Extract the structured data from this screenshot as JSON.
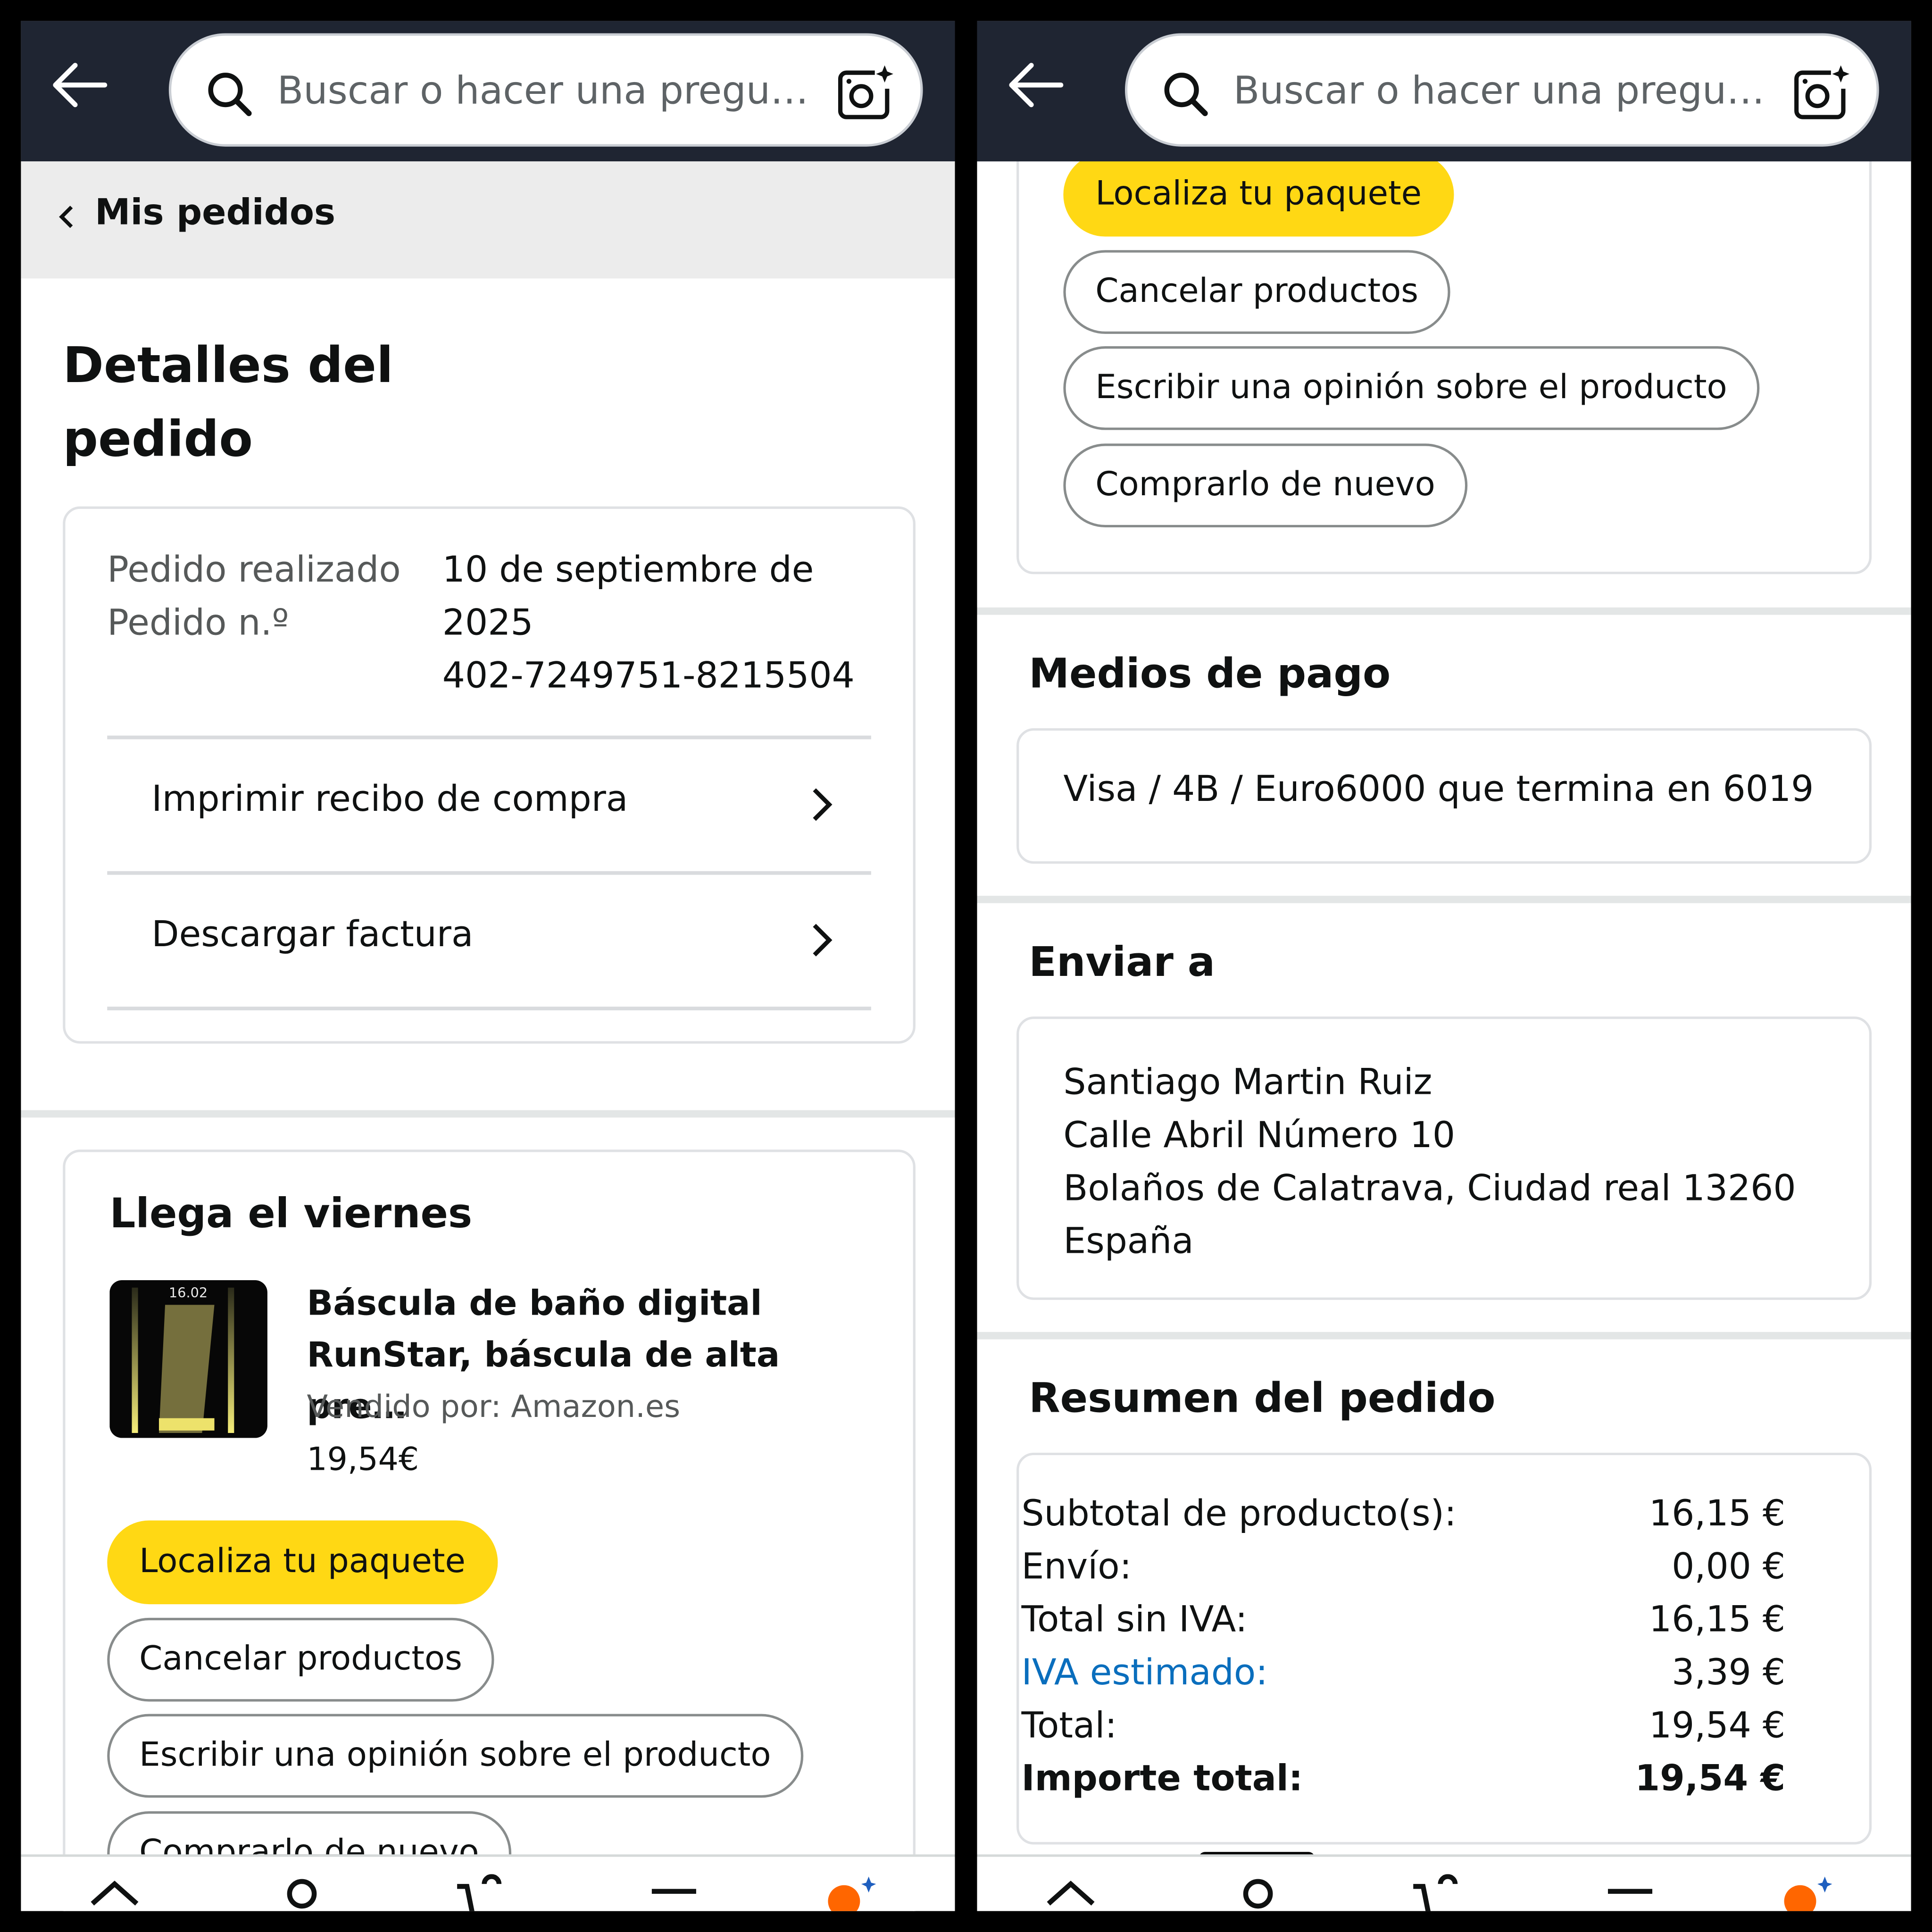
{
  "search": {
    "placeholder": "Buscar o hacer una pregu…"
  },
  "breadcrumb": {
    "label": "Mis pedidos"
  },
  "page_title": {
    "line1": "Detalles del",
    "line2": "pedido"
  },
  "order_info": {
    "placed_label": "Pedido realizado",
    "number_label": "Pedido n.º",
    "date_line1": "10 de septiembre de",
    "date_line2": "2025",
    "order_number": "402-7249751-8215504"
  },
  "order_links": {
    "print_receipt": "Imprimir recibo de compra",
    "download_invoice": "Descargar factura"
  },
  "shipment": {
    "heading": "Llega el viernes",
    "product_title_line1": "Báscula de baño digital",
    "product_title_line2": "RunStar, báscula de alta pre…",
    "seller": "Vendido por: Amazon.es",
    "price": "19,54€",
    "scale_display": "16.02"
  },
  "actions": {
    "track": "Localiza tu paquete",
    "cancel": "Cancelar productos",
    "review": "Escribir una opinión sobre el producto",
    "buy_again": "Comprarlo de nuevo"
  },
  "payment": {
    "heading": "Medios de pago",
    "method": "Visa / 4B / Euro6000  que termina en 6019"
  },
  "shipping": {
    "heading": "Enviar a",
    "name": "Santiago Martin Ruiz",
    "street": "Calle Abril Número 10",
    "city": "Bolaños de Calatrava, Ciudad real 13260",
    "country": "España"
  },
  "summary": {
    "heading": "Resumen del pedido",
    "rows": [
      {
        "label": "Subtotal de producto(s):",
        "value": "16,15 €"
      },
      {
        "label": "Envío:",
        "value": "0,00 €"
      },
      {
        "label": "Total sin IVA:",
        "value": "16,15 €"
      },
      {
        "label": "IVA estimado:",
        "value": "3,39 €"
      },
      {
        "label": "Total:",
        "value": "19,54 €"
      },
      {
        "label": "Importe total:",
        "value": "19,54 €"
      }
    ]
  },
  "colors": {
    "topbar": "#1f2532",
    "primary_button": "#ffd814",
    "link": "#0a6ebd",
    "cart_badge": "#ff6600"
  },
  "icons": [
    "back-arrow-icon",
    "search-icon",
    "camera-lens-icon",
    "chevron-left-icon",
    "chevron-right-icon",
    "home-icon",
    "profile-icon",
    "cart-icon",
    "menu-icon",
    "rufus-icon"
  ]
}
